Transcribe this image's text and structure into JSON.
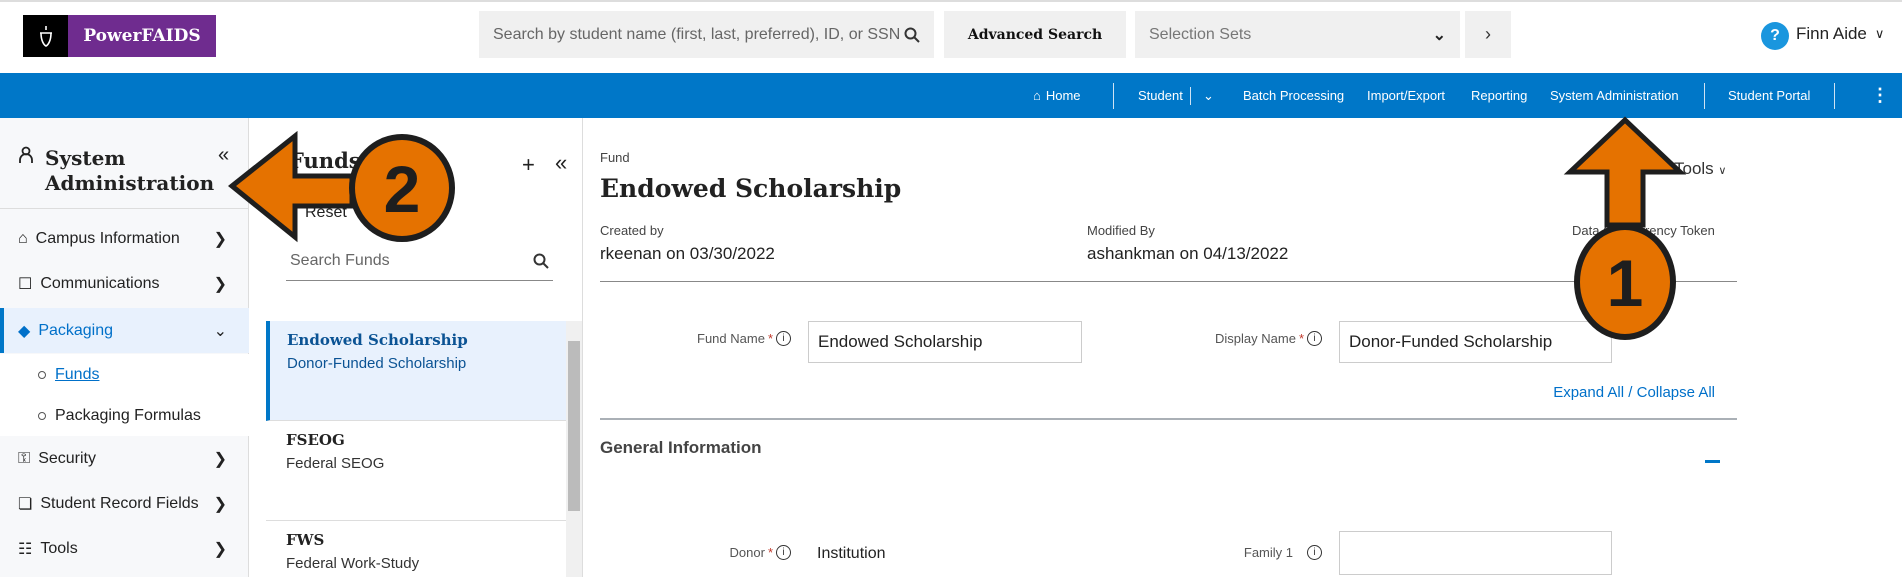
{
  "header": {
    "brand": "PowerFAIDS",
    "search_placeholder": "Search by student name (first, last, preferred), ID, or SSN",
    "advanced_search": "Advanced Search",
    "selection_sets": "Selection Sets",
    "help": "?",
    "user": "Finn Aide"
  },
  "nav": {
    "home": "Home",
    "student": "Student",
    "batch": "Batch Processing",
    "import_export": "Import/Export",
    "reporting": "Reporting",
    "sysadmin": "System Administration",
    "portal": "Student Portal"
  },
  "sidebar": {
    "title_line1": "System",
    "title_line2": "Administration",
    "items": [
      {
        "label": "Campus Information",
        "icon": "campus-gear-icon"
      },
      {
        "label": "Communications",
        "icon": "communications-gear-icon"
      },
      {
        "label": "Packaging",
        "icon": "packaging-tag-icon",
        "selected": true
      },
      {
        "label": "Security",
        "icon": "lock-gear-icon"
      },
      {
        "label": "Student Record Fields",
        "icon": "record-fields-icon"
      },
      {
        "label": "Tools",
        "icon": "tools-gear-icon"
      }
    ],
    "sub_items": [
      {
        "label": "Funds",
        "active": true
      },
      {
        "label": "Packaging Formulas"
      }
    ]
  },
  "funds_panel": {
    "title": "Funds",
    "filters_partial": "s",
    "reset": "Reset",
    "search_placeholder": "Search Funds",
    "items": [
      {
        "code": "Endowed Scholarship",
        "name": "Donor-Funded Scholarship",
        "selected": true
      },
      {
        "code": "FSEOG",
        "name": "Federal SEOG"
      },
      {
        "code": "FWS",
        "name": "Federal Work-Study"
      }
    ]
  },
  "main": {
    "eyebrow": "Fund",
    "title": "Endowed Scholarship",
    "tools": "Tools",
    "created_by_label": "Created by",
    "created_by": "rkeenan on 03/30/2022",
    "modified_by_label": "Modified By",
    "modified_by": "ashankman on 04/13/2022",
    "token_label": "Data Concurrency Token",
    "fund_name_label": "Fund Name",
    "fund_name": "Endowed Scholarship",
    "display_name_label": "Display Name",
    "display_name": "Donor-Funded Scholarship",
    "expand_all": "Expand All",
    "separator": " / ",
    "collapse_all": "Collapse All",
    "section": "General Information",
    "donor_label": "Donor",
    "donor": "Institution",
    "family1_label": "Family 1",
    "family1": ""
  },
  "annotations": [
    {
      "number": "1",
      "points_to": "System Administration"
    },
    {
      "number": "2",
      "points_to": "System Administration sidebar"
    }
  ],
  "colors": {
    "brand_purple": "#6f2c8f",
    "nav_blue": "#0077c8",
    "annotation_orange": "#e57200",
    "link_blue": "#0070c9"
  }
}
